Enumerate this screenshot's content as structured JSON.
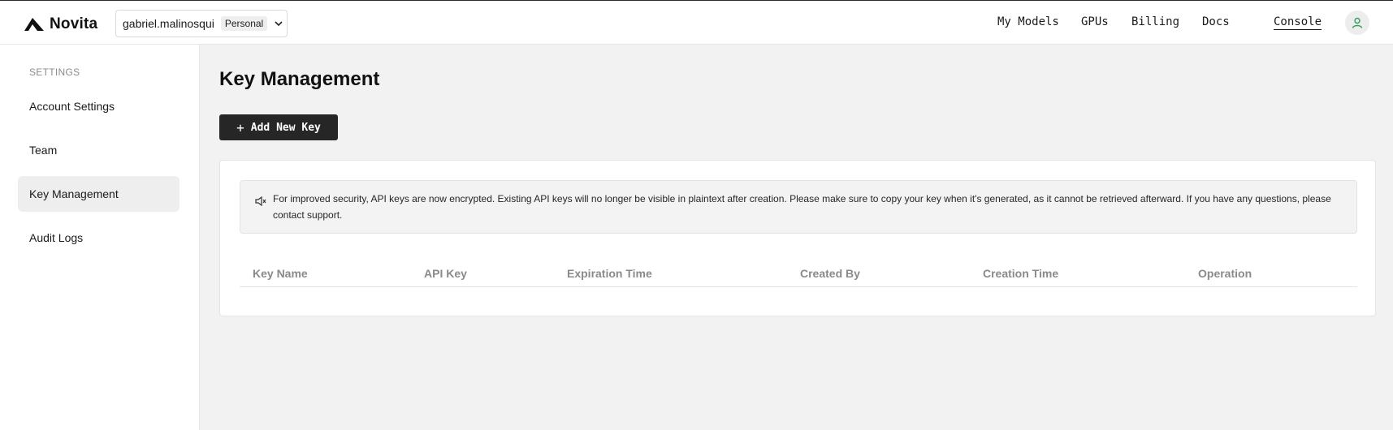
{
  "brand": {
    "name": "Novita"
  },
  "workspace": {
    "name": "gabriel.malinosqui",
    "badge": "Personal"
  },
  "nav": {
    "links": [
      "My Models",
      "GPUs",
      "Billing",
      "Docs"
    ],
    "console": "Console"
  },
  "sidebar": {
    "heading": "SETTINGS",
    "items": [
      {
        "label": "Account Settings",
        "active": false
      },
      {
        "label": "Team",
        "active": false
      },
      {
        "label": "Key Management",
        "active": true
      },
      {
        "label": "Audit Logs",
        "active": false
      }
    ]
  },
  "main": {
    "title": "Key Management",
    "add_button": "Add New Key",
    "notice": "For improved security, API keys are now encrypted. Existing API keys will no longer be visible in plaintext after creation. Please make sure to copy your key when it's generated, as it cannot be retrieved afterward. If you have any questions, please contact support.",
    "table": {
      "columns": [
        "Key Name",
        "API Key",
        "Expiration Time",
        "Created By",
        "Creation Time",
        "Operation"
      ],
      "rows": []
    }
  },
  "icons": {
    "logo": "novita-logo-icon",
    "chevron": "chevron-down-icon",
    "avatar": "user-icon",
    "notice": "speaker-icon",
    "add": "plus-icon"
  },
  "colors": {
    "accent": "#262626",
    "avatar_icon": "#2e9e5b"
  }
}
